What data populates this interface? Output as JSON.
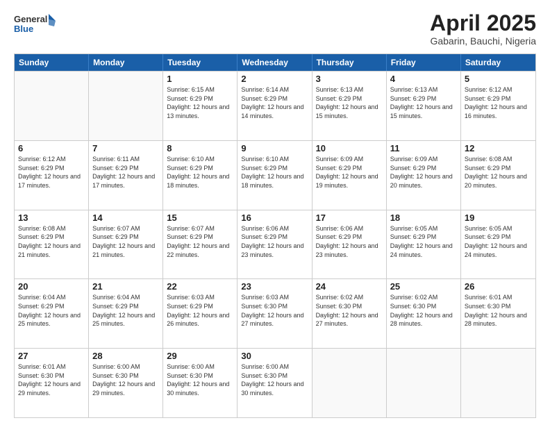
{
  "logo": {
    "line1": "General",
    "line2": "Blue"
  },
  "title": "April 2025",
  "subtitle": "Gabarin, Bauchi, Nigeria",
  "days_of_week": [
    "Sunday",
    "Monday",
    "Tuesday",
    "Wednesday",
    "Thursday",
    "Friday",
    "Saturday"
  ],
  "weeks": [
    [
      {
        "day": "",
        "info": ""
      },
      {
        "day": "",
        "info": ""
      },
      {
        "day": "1",
        "info": "Sunrise: 6:15 AM\nSunset: 6:29 PM\nDaylight: 12 hours and 13 minutes."
      },
      {
        "day": "2",
        "info": "Sunrise: 6:14 AM\nSunset: 6:29 PM\nDaylight: 12 hours and 14 minutes."
      },
      {
        "day": "3",
        "info": "Sunrise: 6:13 AM\nSunset: 6:29 PM\nDaylight: 12 hours and 15 minutes."
      },
      {
        "day": "4",
        "info": "Sunrise: 6:13 AM\nSunset: 6:29 PM\nDaylight: 12 hours and 15 minutes."
      },
      {
        "day": "5",
        "info": "Sunrise: 6:12 AM\nSunset: 6:29 PM\nDaylight: 12 hours and 16 minutes."
      }
    ],
    [
      {
        "day": "6",
        "info": "Sunrise: 6:12 AM\nSunset: 6:29 PM\nDaylight: 12 hours and 17 minutes."
      },
      {
        "day": "7",
        "info": "Sunrise: 6:11 AM\nSunset: 6:29 PM\nDaylight: 12 hours and 17 minutes."
      },
      {
        "day": "8",
        "info": "Sunrise: 6:10 AM\nSunset: 6:29 PM\nDaylight: 12 hours and 18 minutes."
      },
      {
        "day": "9",
        "info": "Sunrise: 6:10 AM\nSunset: 6:29 PM\nDaylight: 12 hours and 18 minutes."
      },
      {
        "day": "10",
        "info": "Sunrise: 6:09 AM\nSunset: 6:29 PM\nDaylight: 12 hours and 19 minutes."
      },
      {
        "day": "11",
        "info": "Sunrise: 6:09 AM\nSunset: 6:29 PM\nDaylight: 12 hours and 20 minutes."
      },
      {
        "day": "12",
        "info": "Sunrise: 6:08 AM\nSunset: 6:29 PM\nDaylight: 12 hours and 20 minutes."
      }
    ],
    [
      {
        "day": "13",
        "info": "Sunrise: 6:08 AM\nSunset: 6:29 PM\nDaylight: 12 hours and 21 minutes."
      },
      {
        "day": "14",
        "info": "Sunrise: 6:07 AM\nSunset: 6:29 PM\nDaylight: 12 hours and 21 minutes."
      },
      {
        "day": "15",
        "info": "Sunrise: 6:07 AM\nSunset: 6:29 PM\nDaylight: 12 hours and 22 minutes."
      },
      {
        "day": "16",
        "info": "Sunrise: 6:06 AM\nSunset: 6:29 PM\nDaylight: 12 hours and 23 minutes."
      },
      {
        "day": "17",
        "info": "Sunrise: 6:06 AM\nSunset: 6:29 PM\nDaylight: 12 hours and 23 minutes."
      },
      {
        "day": "18",
        "info": "Sunrise: 6:05 AM\nSunset: 6:29 PM\nDaylight: 12 hours and 24 minutes."
      },
      {
        "day": "19",
        "info": "Sunrise: 6:05 AM\nSunset: 6:29 PM\nDaylight: 12 hours and 24 minutes."
      }
    ],
    [
      {
        "day": "20",
        "info": "Sunrise: 6:04 AM\nSunset: 6:29 PM\nDaylight: 12 hours and 25 minutes."
      },
      {
        "day": "21",
        "info": "Sunrise: 6:04 AM\nSunset: 6:29 PM\nDaylight: 12 hours and 25 minutes."
      },
      {
        "day": "22",
        "info": "Sunrise: 6:03 AM\nSunset: 6:29 PM\nDaylight: 12 hours and 26 minutes."
      },
      {
        "day": "23",
        "info": "Sunrise: 6:03 AM\nSunset: 6:30 PM\nDaylight: 12 hours and 27 minutes."
      },
      {
        "day": "24",
        "info": "Sunrise: 6:02 AM\nSunset: 6:30 PM\nDaylight: 12 hours and 27 minutes."
      },
      {
        "day": "25",
        "info": "Sunrise: 6:02 AM\nSunset: 6:30 PM\nDaylight: 12 hours and 28 minutes."
      },
      {
        "day": "26",
        "info": "Sunrise: 6:01 AM\nSunset: 6:30 PM\nDaylight: 12 hours and 28 minutes."
      }
    ],
    [
      {
        "day": "27",
        "info": "Sunrise: 6:01 AM\nSunset: 6:30 PM\nDaylight: 12 hours and 29 minutes."
      },
      {
        "day": "28",
        "info": "Sunrise: 6:00 AM\nSunset: 6:30 PM\nDaylight: 12 hours and 29 minutes."
      },
      {
        "day": "29",
        "info": "Sunrise: 6:00 AM\nSunset: 6:30 PM\nDaylight: 12 hours and 30 minutes."
      },
      {
        "day": "30",
        "info": "Sunrise: 6:00 AM\nSunset: 6:30 PM\nDaylight: 12 hours and 30 minutes."
      },
      {
        "day": "",
        "info": ""
      },
      {
        "day": "",
        "info": ""
      },
      {
        "day": "",
        "info": ""
      }
    ]
  ]
}
